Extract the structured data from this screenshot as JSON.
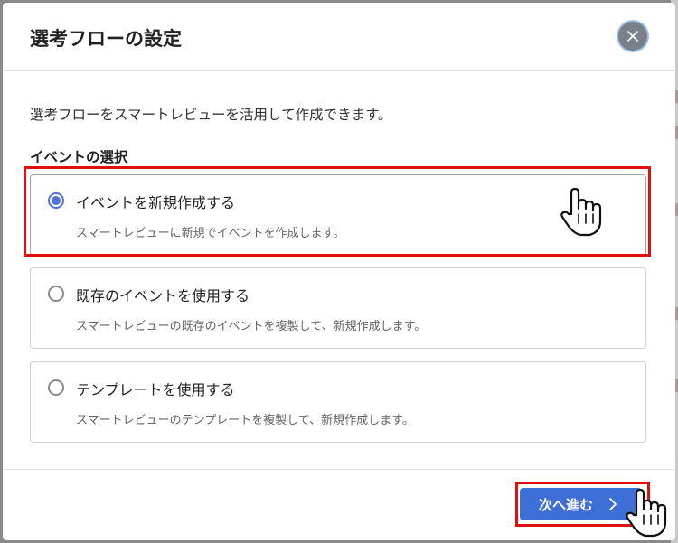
{
  "dialog": {
    "title": "選考フローの設定",
    "close_icon": "close-icon",
    "intro": "選考フローをスマートレビューを活用して作成できます。",
    "section_title": "イベントの選択",
    "options": [
      {
        "label": "イベントを新規作成する",
        "description": "スマートレビューに新規でイベントを作成します。",
        "selected": true
      },
      {
        "label": "既存のイベントを使用する",
        "description": "スマートレビューの既存のイベントを複製して、新規作成します。",
        "selected": false
      },
      {
        "label": "テンプレートを使用する",
        "description": "スマートレビューのテンプレートを複製して、新規作成します。",
        "selected": false
      }
    ],
    "next_button": {
      "label": "次へ進む",
      "icon": "chevron-right-icon"
    }
  },
  "colors": {
    "accent": "#3d6fd6",
    "highlight": "#e01010",
    "radio": "#4d75d1"
  }
}
